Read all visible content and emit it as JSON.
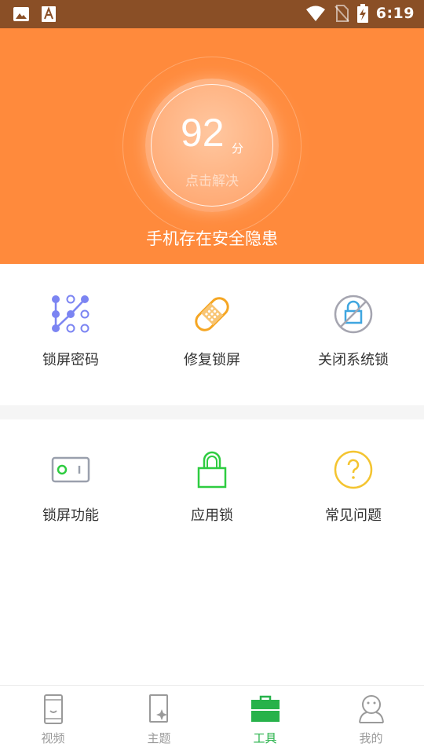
{
  "status_bar": {
    "time": "6:19"
  },
  "hero": {
    "score": "92",
    "score_unit": "分",
    "action": "点击解决",
    "status": "手机存在安全隐患"
  },
  "tools_row1": [
    {
      "label": "锁屏密码",
      "icon": "pattern-lock-icon"
    },
    {
      "label": "修复锁屏",
      "icon": "bandage-icon"
    },
    {
      "label": "关闭系统锁",
      "icon": "lock-disabled-icon"
    }
  ],
  "tools_row2": [
    {
      "label": "锁屏功能",
      "icon": "toggle-switch-icon"
    },
    {
      "label": "应用锁",
      "icon": "app-lock-icon"
    },
    {
      "label": "常见问题",
      "icon": "question-icon"
    }
  ],
  "bottom_nav": [
    {
      "label": "视频",
      "icon": "video-phone-icon",
      "active": false
    },
    {
      "label": "主题",
      "icon": "theme-icon",
      "active": false
    },
    {
      "label": "工具",
      "icon": "toolbox-icon",
      "active": true
    },
    {
      "label": "我的",
      "icon": "profile-icon",
      "active": false
    }
  ],
  "colors": {
    "hero_bg": "#ff8a3c",
    "status_bar_bg": "#8a4f26",
    "active_green": "#27b24a"
  }
}
